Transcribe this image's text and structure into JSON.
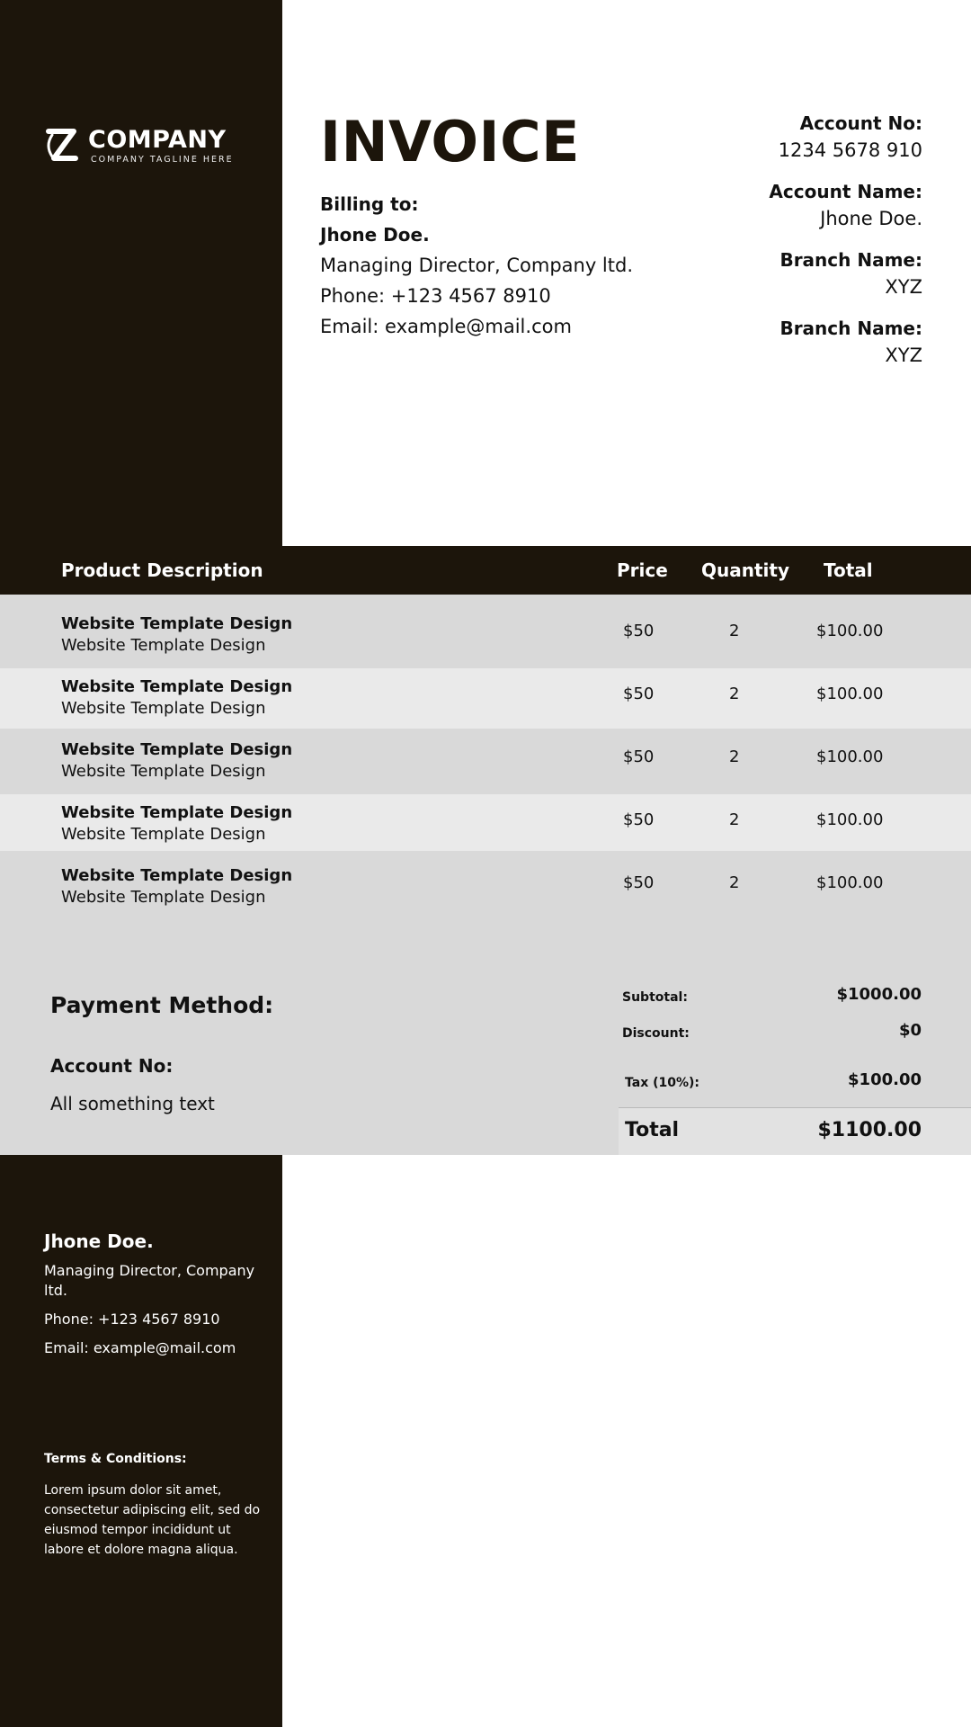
{
  "brand": {
    "name": "COMPANY",
    "tagline": "COMPANY TAGLINE HERE",
    "dark_color": "#1c150b",
    "icon": "company-logo-icon"
  },
  "invoice": {
    "title": "INVOICE"
  },
  "billing": {
    "label": "Billing to:",
    "name": "Jhone Doe.",
    "role": "Managing Director, Company ltd.",
    "phone": "Phone: +123 4567 8910",
    "email": "Email: example@mail.com"
  },
  "account_info": [
    {
      "label": "Account No:",
      "value": "1234 5678 910"
    },
    {
      "label": "Account Name:",
      "value": "Jhone Doe."
    },
    {
      "label": "Branch Name:",
      "value": "XYZ"
    },
    {
      "label": "Branch Name:",
      "value": "XYZ"
    }
  ],
  "table": {
    "headers": {
      "description": "Product Description",
      "price": "Price",
      "quantity": "Quantity",
      "total": "Total"
    },
    "rows": [
      {
        "title": "Website Template Design",
        "subtitle": "Website Template Design",
        "price": "$50",
        "quantity": "2",
        "total": "$100.00"
      },
      {
        "title": "Website Template Design",
        "subtitle": "Website Template Design",
        "price": "$50",
        "quantity": "2",
        "total": "$100.00"
      },
      {
        "title": "Website Template Design",
        "subtitle": "Website Template Design",
        "price": "$50",
        "quantity": "2",
        "total": "$100.00"
      },
      {
        "title": "Website Template Design",
        "subtitle": "Website Template Design",
        "price": "$50",
        "quantity": "2",
        "total": "$100.00"
      },
      {
        "title": "Website Template Design",
        "subtitle": "Website Template Design",
        "price": "$50",
        "quantity": "2",
        "total": "$100.00"
      }
    ]
  },
  "payment": {
    "title": "Payment Method:",
    "account_label": "Account No:",
    "account_value": "All something text"
  },
  "summary": {
    "subtotal_label": "Subtotal:",
    "subtotal_value": "$1000.00",
    "discount_label": "Discount:",
    "discount_value": "$0",
    "tax_label": "Tax (10%):",
    "tax_value": "$100.00",
    "total_label": "Total",
    "total_value": "$1100.00"
  },
  "contact": {
    "name": "Jhone Doe.",
    "role": "Managing Director, Company ltd.",
    "phone": "Phone: +123 4567 8910",
    "email": "Email: example@mail.com"
  },
  "terms": {
    "title": "Terms & Conditions:",
    "body": "Lorem ipsum dolor sit amet, consectetur adipiscing elit, sed do eiusmod tempor incididunt ut labore et dolore magna aliqua."
  }
}
